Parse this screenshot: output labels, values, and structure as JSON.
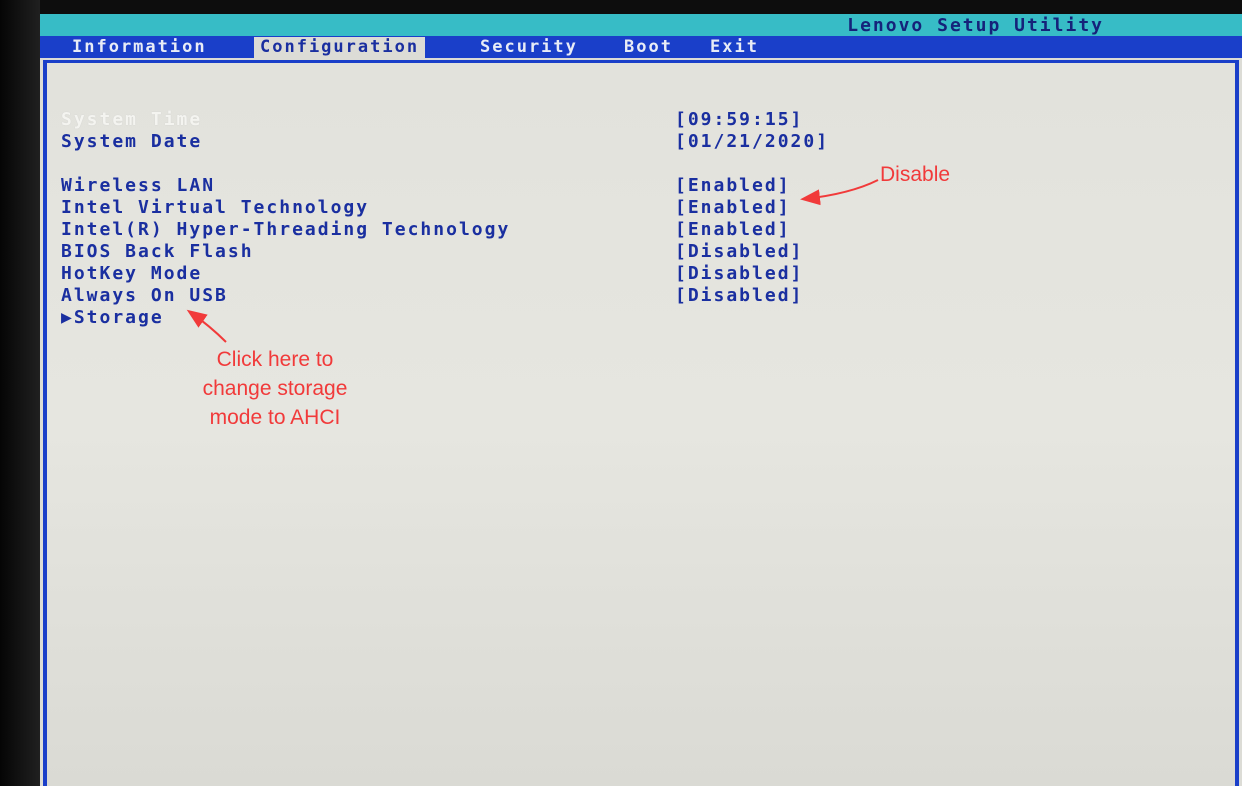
{
  "app": {
    "title": "Lenovo Setup Utility"
  },
  "menu": {
    "tabs": [
      {
        "label": "Information"
      },
      {
        "label": "Configuration",
        "active": true
      },
      {
        "label": "Security"
      },
      {
        "label": "Boot"
      },
      {
        "label": "Exit"
      }
    ]
  },
  "settings": [
    {
      "label": "System Time",
      "value": "[09:59:15]",
      "highlighted": true
    },
    {
      "label": "System Date",
      "value": "[01/21/2020]"
    },
    {
      "label": "Wireless LAN",
      "value": "[Enabled]"
    },
    {
      "label": "Intel Virtual Technology",
      "value": "[Enabled]"
    },
    {
      "label": "Intel(R) Hyper-Threading Technology",
      "value": "[Enabled]"
    },
    {
      "label": "BIOS Back Flash",
      "value": "[Disabled]"
    },
    {
      "label": "HotKey Mode",
      "value": "[Disabled]"
    },
    {
      "label": "Always On USB",
      "value": "[Disabled]"
    },
    {
      "label": "▶Storage",
      "value": ""
    }
  ],
  "annotations": {
    "disable_note": "Disable",
    "storage_note_line1": "Click here to",
    "storage_note_line2": "change storage",
    "storage_note_line3": "mode to AHCI"
  },
  "colors": {
    "menu_bar": "#1a3fc9",
    "title_bar": "#37bcc6",
    "text": "#1a2fa0",
    "annotation": "#f13a3a",
    "background": "#e2e2dc"
  }
}
